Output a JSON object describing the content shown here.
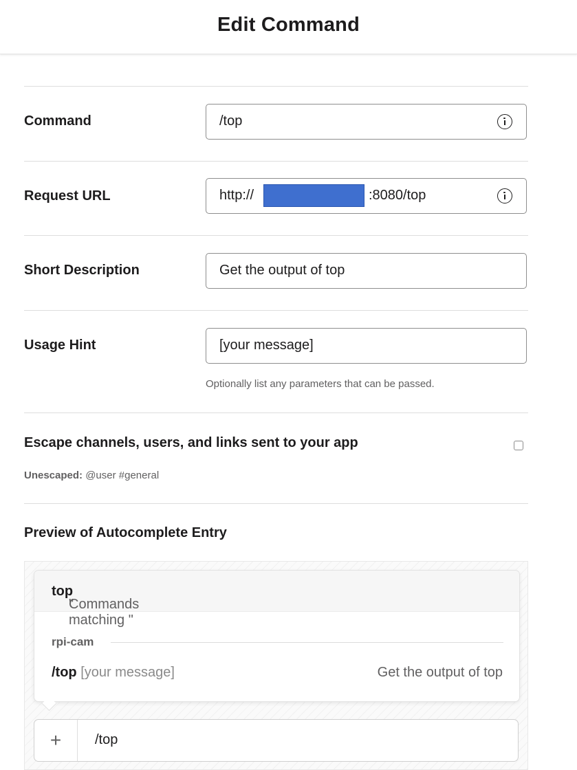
{
  "header": {
    "title": "Edit Command"
  },
  "form": {
    "command": {
      "label": "Command",
      "value": "/top"
    },
    "request_url": {
      "label": "Request URL",
      "prefix": "http://",
      "suffix": ":8080/top",
      "redaction_color": "#3f6fcf"
    },
    "short_description": {
      "label": "Short Description",
      "value": "Get the output of top"
    },
    "usage_hint": {
      "label": "Usage Hint",
      "value": "[your message]",
      "help": "Optionally list any parameters that can be passed."
    },
    "escape": {
      "label": "Escape channels, users, and links sent to your app",
      "checked": false,
      "example_label": "Unescaped:",
      "example_value": " @user #general"
    }
  },
  "preview": {
    "title": "Preview of Autocomplete Entry",
    "matching_prefix": "Commands matching \"",
    "matching_term": "top",
    "matching_suffix": "\"",
    "app_name": "rpi-cam",
    "command": "/top",
    "hint": " [your message]",
    "description": "Get the output of top",
    "composer_plus": "+",
    "composer_text": "/top"
  }
}
